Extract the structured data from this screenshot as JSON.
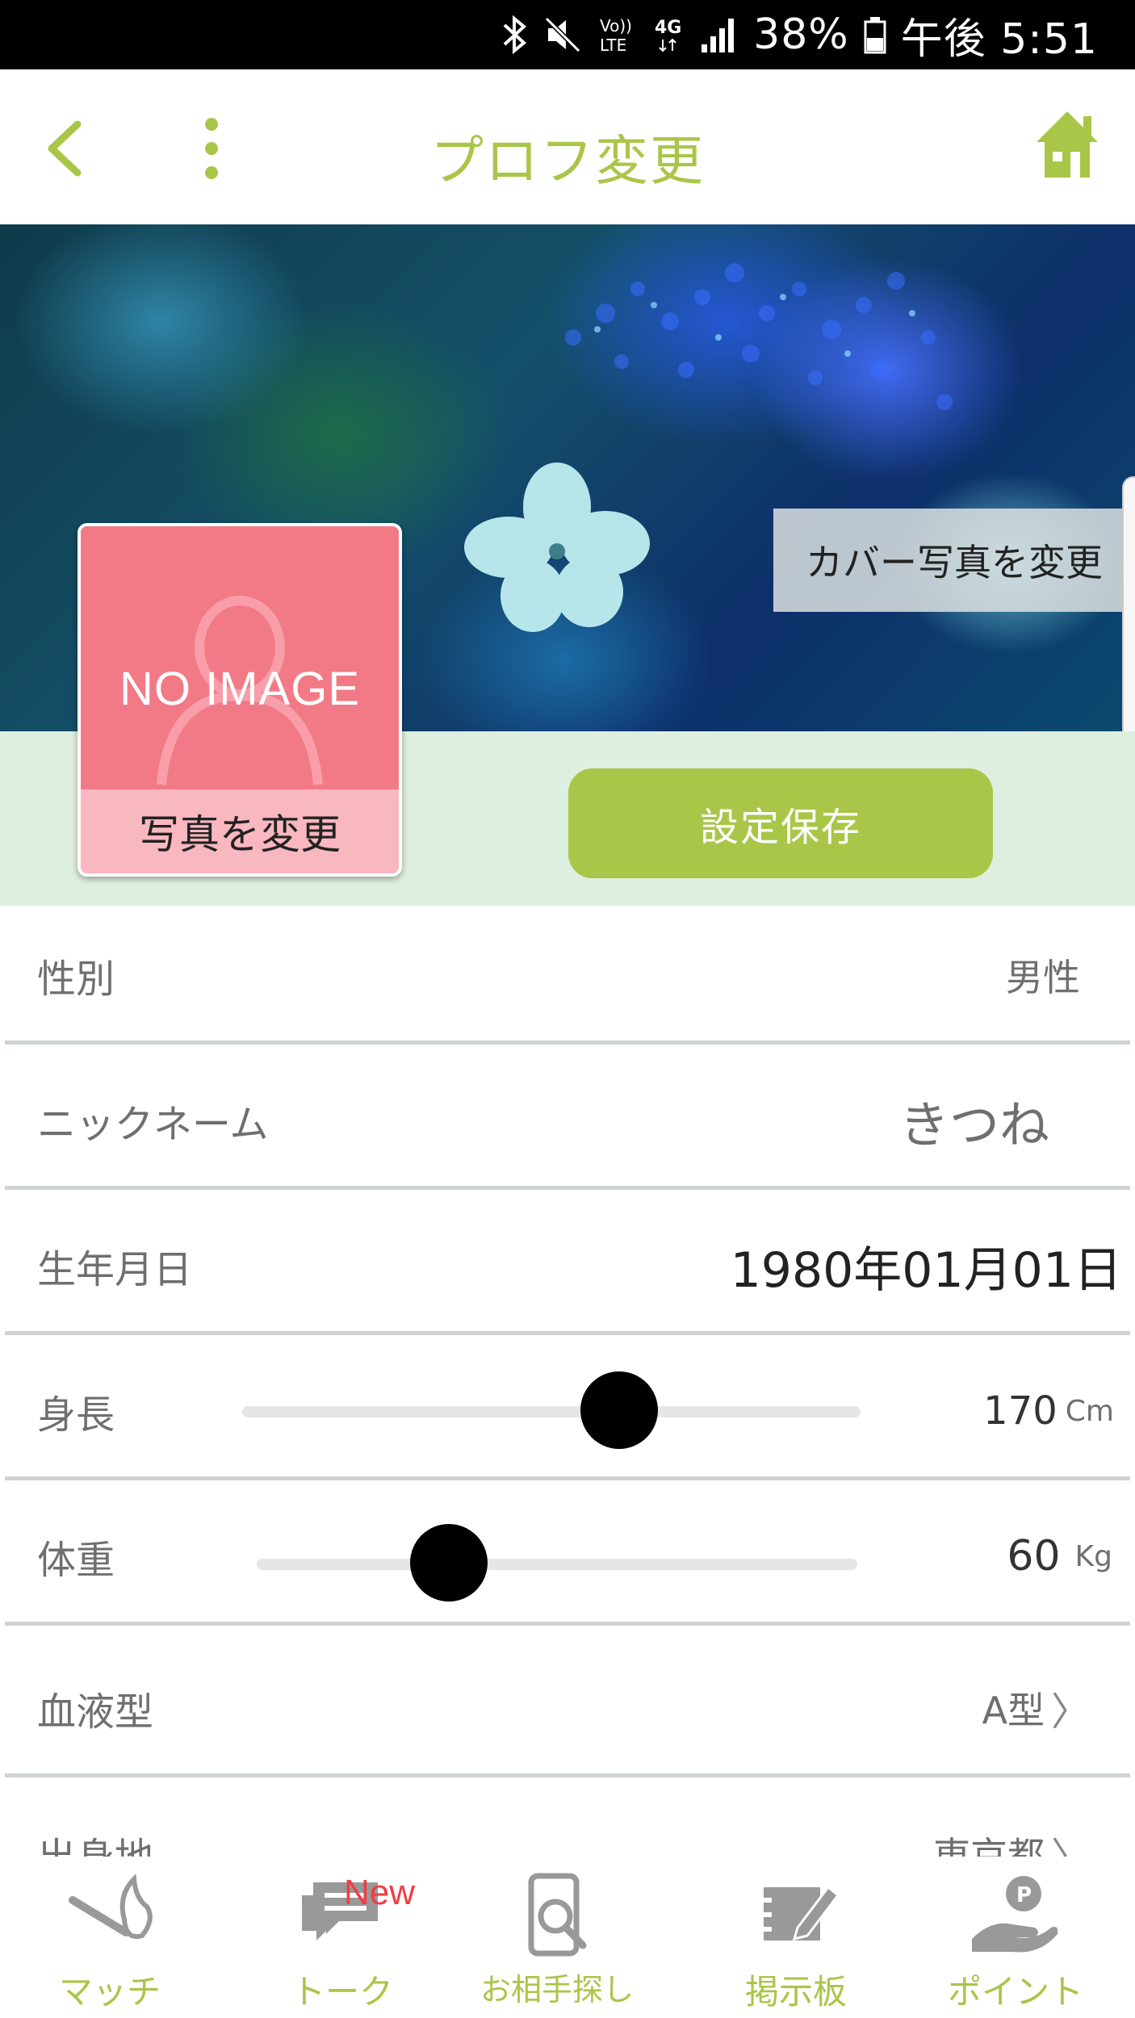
{
  "status_bar": {
    "battery": "38%",
    "time": "午後 5:51",
    "network": "4G",
    "volte": "VoLTE",
    "icons": [
      "bluetooth-icon",
      "mute-icon",
      "volte-icon",
      "network-4g-icon",
      "signal-icon",
      "battery-icon"
    ]
  },
  "header": {
    "title": "プロフ変更",
    "back_icon": "chevron-left-icon",
    "menu_icon": "vertical-dots-icon",
    "home_icon": "home-icon"
  },
  "cover": {
    "change_cover_label": "カバー写真を変更"
  },
  "profile": {
    "no_image_text": "NO IMAGE",
    "change_photo_label": "写真を変更",
    "save_label": "設定保存"
  },
  "fields": {
    "gender": {
      "label": "性別",
      "value": "男性"
    },
    "nickname": {
      "label": "ニックネーム",
      "value": "きつね"
    },
    "birthday": {
      "label": "生年月日",
      "value": "1980年01月01日"
    },
    "height": {
      "label": "身長",
      "value": "170",
      "unit": "Cm",
      "slider_fraction": 0.61
    },
    "weight": {
      "label": "体重",
      "value": "60",
      "unit": "Kg",
      "slider_fraction": 0.32
    },
    "blood_type": {
      "label": "血液型",
      "value": "A型"
    },
    "birthplace": {
      "label": "出身地",
      "value": "東京都"
    }
  },
  "bottom_nav": [
    {
      "label": "マッチ",
      "icon": "match-icon"
    },
    {
      "label": "トーク",
      "icon": "talk-icon",
      "badge": "New"
    },
    {
      "label": "お相手探し",
      "icon": "search-phone-icon"
    },
    {
      "label": "掲示板",
      "icon": "board-icon"
    },
    {
      "label": "ポイント",
      "icon": "points-icon"
    }
  ],
  "colors": {
    "accent": "#a9c648",
    "band": "#deefdf",
    "avatar": "#f27a86",
    "avatar_button": "#f9b7c0",
    "badge": "#ef3e44"
  }
}
